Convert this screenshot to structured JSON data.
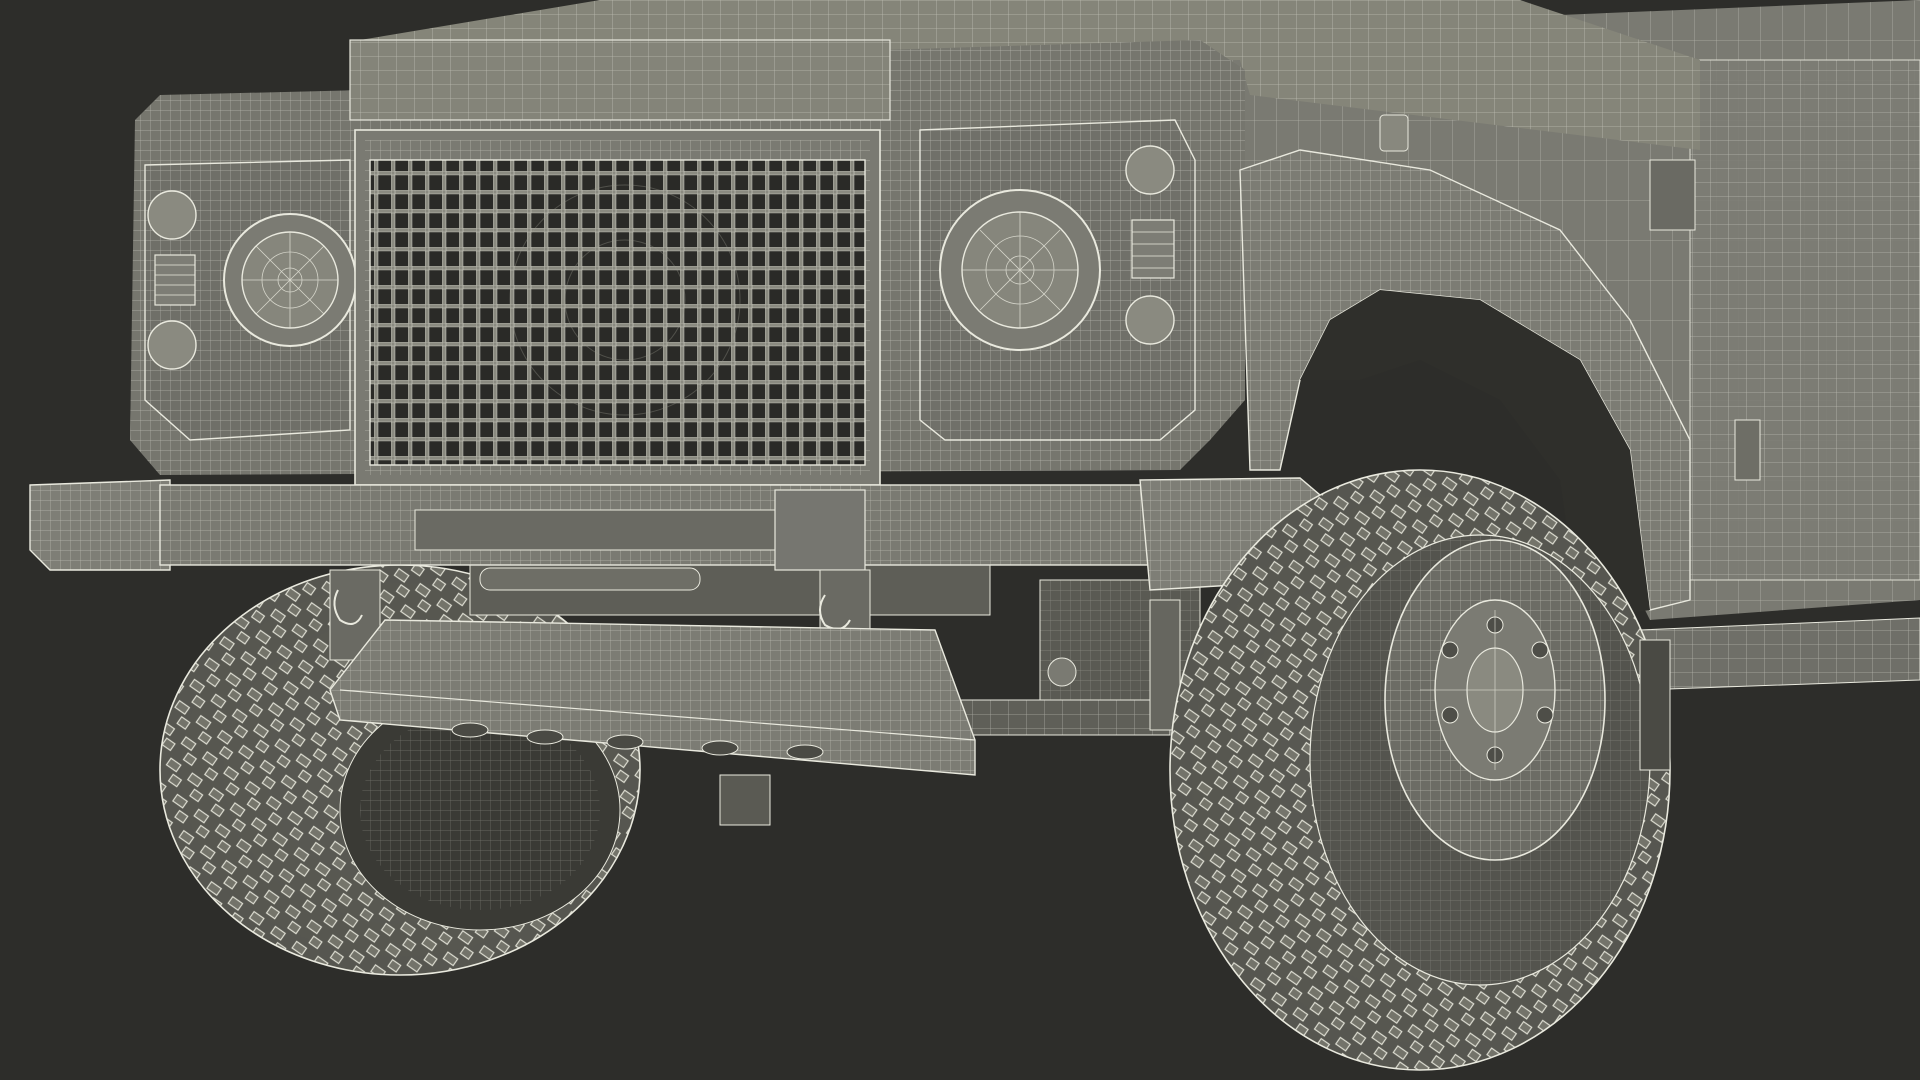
{
  "scene": {
    "subject": "offroad-vehicle-front-wireframe",
    "render_style": "wireframe-over-clay",
    "colors": {
      "background": "#2d2d2a",
      "body": "#7a7a72",
      "body_dark": "#5e5e57",
      "body_shadow": "#45453f",
      "wire": "#e9e9de",
      "tire": "#6c6c64",
      "tire_dark": "#3f3f3a",
      "grille_bg": "#2a2a27"
    }
  },
  "parts": [
    {
      "name": "hood",
      "icon": "hood-shape"
    },
    {
      "name": "front-grille",
      "icon": "grid-grille-icon"
    },
    {
      "name": "left-headlight",
      "icon": "headlight-icon"
    },
    {
      "name": "right-headlight",
      "icon": "headlight-icon"
    },
    {
      "name": "front-bumper",
      "icon": "bumper-bar"
    },
    {
      "name": "skid-plate",
      "icon": "skid-plate"
    },
    {
      "name": "left-front-tire",
      "icon": "offroad-tire-icon"
    },
    {
      "name": "right-front-tire",
      "icon": "offroad-tire-icon"
    },
    {
      "name": "right-wheel-arch",
      "icon": "fender-flare"
    },
    {
      "name": "right-wheel-rim",
      "icon": "wheel-rim-icon"
    },
    {
      "name": "tow-hooks",
      "icon": "tow-hook-icon"
    }
  ]
}
